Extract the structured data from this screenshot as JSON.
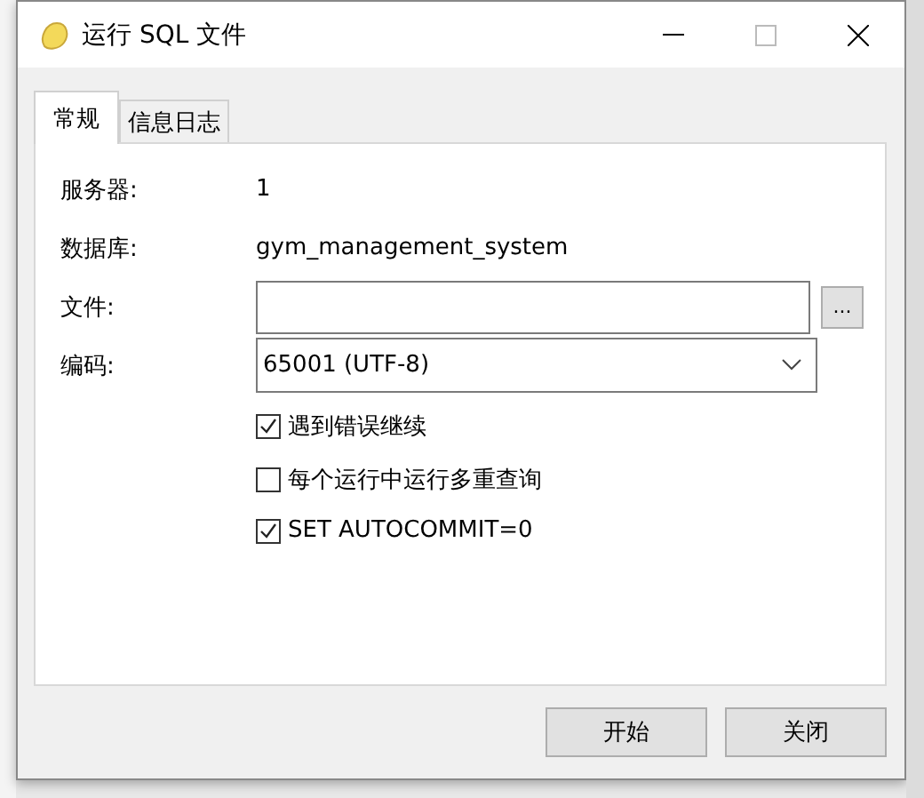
{
  "window": {
    "title": "运行 SQL 文件"
  },
  "tabs": [
    {
      "label": "常规",
      "selected": true
    },
    {
      "label": "信息日志",
      "selected": false
    }
  ],
  "fields": [
    {
      "kind": "text",
      "label": "服务器:",
      "value": "1"
    },
    {
      "kind": "text",
      "label": "数据库:",
      "value": "gym_management_system"
    },
    {
      "kind": "file",
      "label": "文件:",
      "browse": "..."
    },
    {
      "kind": "select",
      "label": "编码:",
      "value": "65001 (UTF-8)"
    }
  ],
  "options": [
    {
      "label": "遇到错误继续",
      "checked": true
    },
    {
      "label": "每个运行中运行多重查询",
      "checked": false
    },
    {
      "label": "SET AUTOCOMMIT=0",
      "checked": true
    }
  ],
  "buttons": [
    "开始",
    "关闭"
  ]
}
